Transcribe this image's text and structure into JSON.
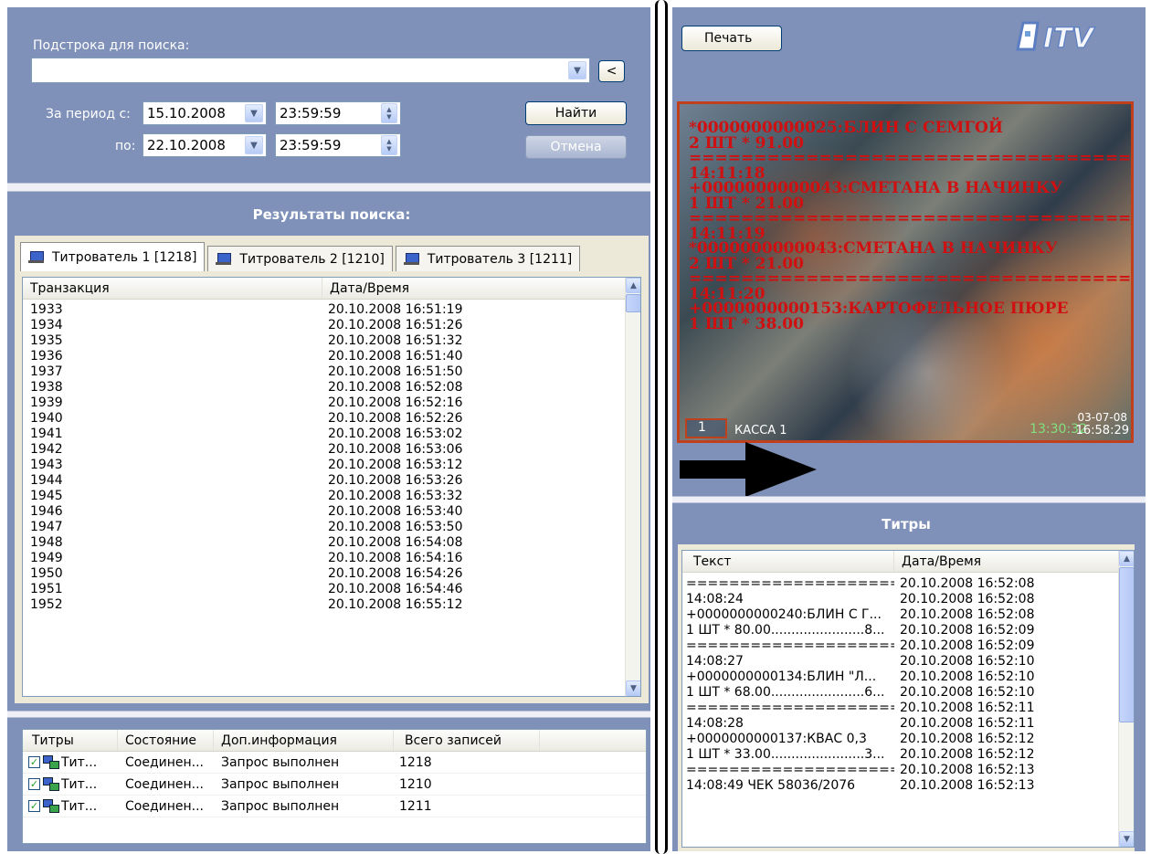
{
  "search": {
    "label": "Подстрока для поиска:",
    "value": "",
    "back_btn": "<",
    "period_from_label": "За период с:",
    "period_to_label": "по:",
    "date_from": "15.10.2008",
    "time_from": "23:59:59",
    "date_to": "22.10.2008",
    "time_to": "23:59:59",
    "find_btn": "Найти",
    "cancel_btn": "Отмена"
  },
  "results": {
    "title": "Результаты поиска:",
    "tabs": [
      "Титрователь 1 [1218]",
      "Титрователь 2 [1210]",
      "Титрователь 3 [1211]"
    ],
    "columns": [
      "Транзакция",
      "Дата/Время"
    ],
    "rows": [
      [
        "1933",
        "20.10.2008 16:51:19"
      ],
      [
        "1934",
        "20.10.2008 16:51:26"
      ],
      [
        "1935",
        "20.10.2008 16:51:32"
      ],
      [
        "1936",
        "20.10.2008 16:51:40"
      ],
      [
        "1937",
        "20.10.2008 16:51:50"
      ],
      [
        "1938",
        "20.10.2008 16:52:08"
      ],
      [
        "1939",
        "20.10.2008 16:52:16"
      ],
      [
        "1940",
        "20.10.2008 16:52:26"
      ],
      [
        "1941",
        "20.10.2008 16:53:02"
      ],
      [
        "1942",
        "20.10.2008 16:53:06"
      ],
      [
        "1943",
        "20.10.2008 16:53:12"
      ],
      [
        "1944",
        "20.10.2008 16:53:26"
      ],
      [
        "1945",
        "20.10.2008 16:53:32"
      ],
      [
        "1946",
        "20.10.2008 16:53:40"
      ],
      [
        "1947",
        "20.10.2008 16:53:50"
      ],
      [
        "1948",
        "20.10.2008 16:54:08"
      ],
      [
        "1949",
        "20.10.2008 16:54:16"
      ],
      [
        "1950",
        "20.10.2008 16:54:26"
      ],
      [
        "1951",
        "20.10.2008 16:54:46"
      ],
      [
        "1952",
        "20.10.2008 16:55:12"
      ]
    ]
  },
  "status_table": {
    "columns": [
      "Титры",
      "Состояние",
      "Доп.информация",
      "Всего записей"
    ],
    "rows": [
      [
        "Тит...",
        "Соединен...",
        "Запрос выполнен",
        "1218"
      ],
      [
        "Тит...",
        "Соединен...",
        "Запрос выполнен",
        "1210"
      ],
      [
        "Тит...",
        "Соединен...",
        "Запрос выполнен",
        "1211"
      ]
    ]
  },
  "right": {
    "print_btn": "Печать",
    "logo": "ITV",
    "video": {
      "overlay_lines": [
        "*0000000000025:БЛИН С СЕМГОЙ",
        "2 ШТ * 91.00",
        "==================================",
        "14:11:18",
        "+0000000000043:СМЕТАНА В НАЧИНКУ",
        "1 ШТ * 21.00",
        "==================================",
        "14:11:19",
        "*0000000000043:СМЕТАНА В НАЧИНКУ",
        "2 ШТ * 21.00",
        "==================================",
        "14:11:20",
        "+0000000000153:КАРТОФЕЛЬНОЕ ПЮРЕ",
        "1 ШТ * 38.00"
      ],
      "cam_number": "1",
      "cam_name": "КАССА 1",
      "date_stamp": "03-07-08",
      "time_stamp": "13:30:32",
      "time_stamp2": "16:58:29"
    },
    "titles_header": "Титры",
    "titles_columns": [
      "Текст",
      "Дата/Время"
    ],
    "titles_rows": [
      [
        "======================...",
        "20.10.2008 16:52:08"
      ],
      [
        "14:08:24",
        "20.10.2008 16:52:08"
      ],
      [
        "+0000000000240:БЛИН С Г...",
        "20.10.2008 16:52:08"
      ],
      [
        "1 ШТ * 80.00.......................8...",
        "20.10.2008 16:52:09"
      ],
      [
        "======================...",
        "20.10.2008 16:52:09"
      ],
      [
        "14:08:27",
        "20.10.2008 16:52:10"
      ],
      [
        "+0000000000134:БЛИН \"Л...",
        "20.10.2008 16:52:10"
      ],
      [
        "1 ШТ * 68.00.......................6...",
        "20.10.2008 16:52:10"
      ],
      [
        "======================...",
        "20.10.2008 16:52:11"
      ],
      [
        "14:08:28",
        "20.10.2008 16:52:11"
      ],
      [
        "+0000000000137:КВАС 0,3",
        "20.10.2008 16:52:12"
      ],
      [
        "1 ШТ * 33.00.......................3...",
        "20.10.2008 16:52:12"
      ],
      [
        "======================...",
        "20.10.2008 16:52:13"
      ],
      [
        "14:08:49  ЧЕК 58036/2076",
        "20.10.2008 16:52:13"
      ]
    ]
  },
  "colors": {
    "panel": "#7f91b9",
    "overlay_text": "#d01010",
    "video_border": "#c0401e"
  }
}
